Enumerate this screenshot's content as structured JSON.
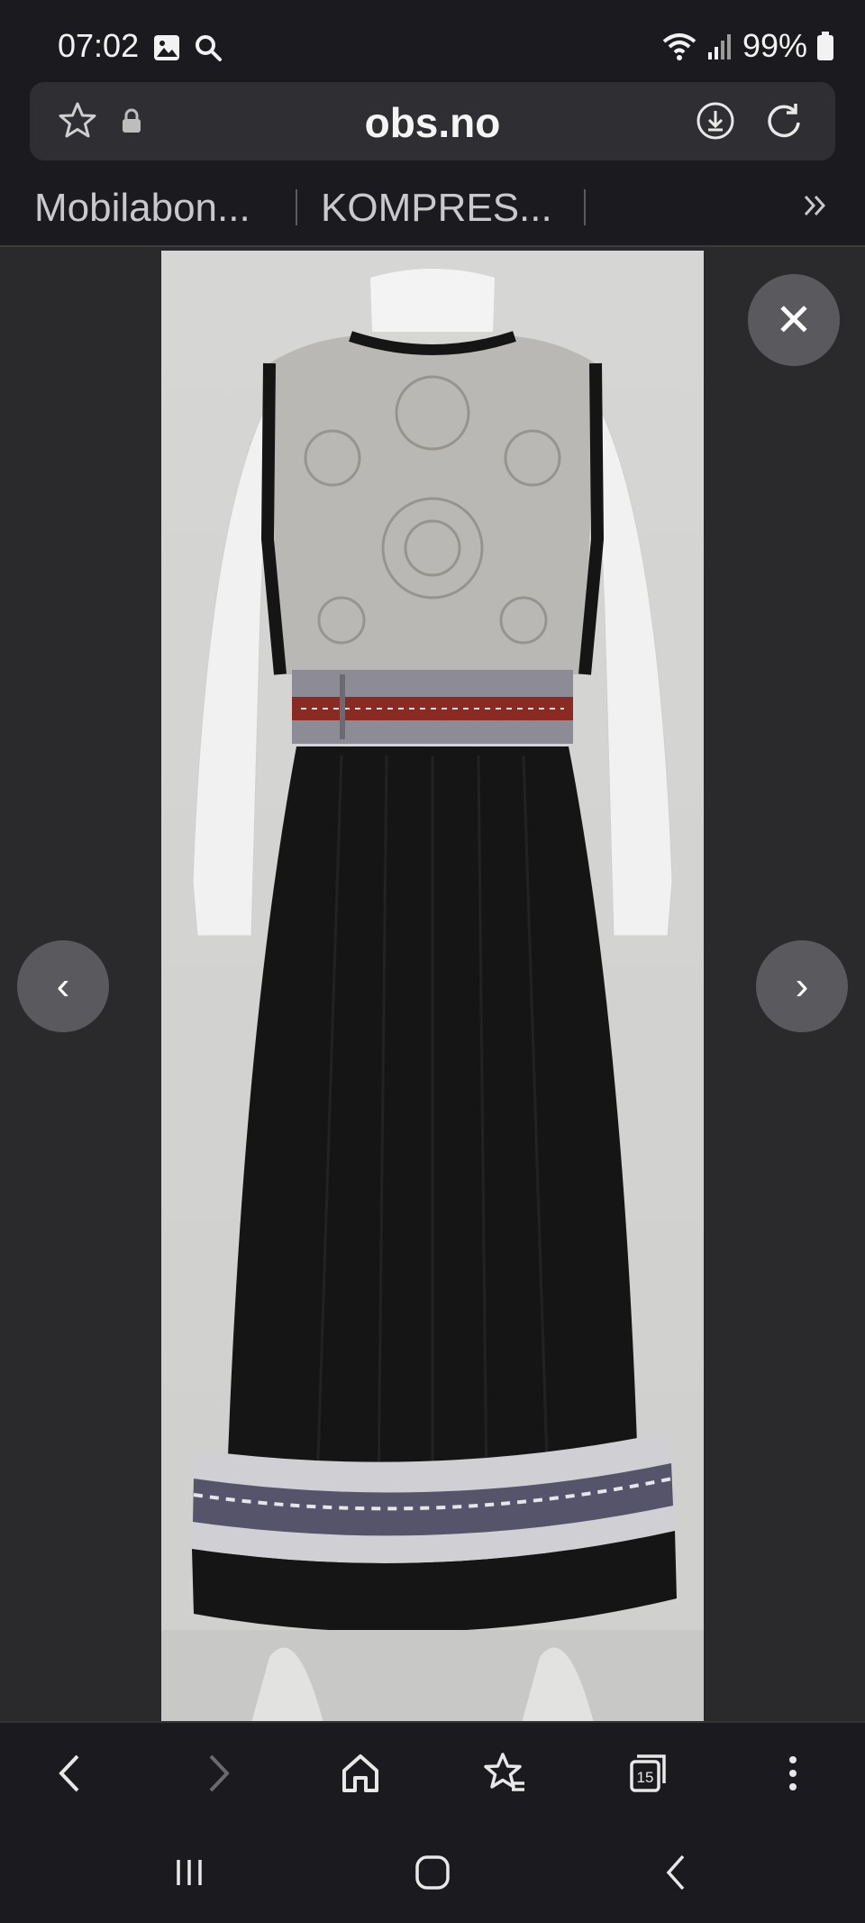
{
  "status": {
    "time": "07:02",
    "battery": "99%",
    "icons": [
      "image-notification-icon",
      "search-notification-icon",
      "wifi-icon",
      "signal-icon",
      "battery-icon"
    ]
  },
  "address_bar": {
    "url": "obs.no",
    "icons": [
      "star-icon",
      "lock-icon",
      "download-icon",
      "refresh-icon"
    ]
  },
  "bookmarks": {
    "items": [
      {
        "label": "Mobilabon..."
      },
      {
        "label": "KOMPRES..."
      }
    ],
    "more_icon": "chevron-double-right-icon"
  },
  "viewer": {
    "close_glyph": "✕",
    "prev_glyph": "‹",
    "next_glyph": "›",
    "image_alt": "bunad"
  },
  "toolbar": {
    "items": [
      "back-icon",
      "forward-icon",
      "home-icon",
      "bookmarks-icon",
      "tabs-icon",
      "menu-icon"
    ],
    "tab_count": "15"
  },
  "system_nav": {
    "items": [
      "recent-apps-icon",
      "home-button-icon",
      "back-icon"
    ]
  },
  "colors": {
    "background": "#1b1b1f",
    "panel": "#2e2e33",
    "viewer": "#2a2a2d",
    "button": "#5a5a5e"
  }
}
